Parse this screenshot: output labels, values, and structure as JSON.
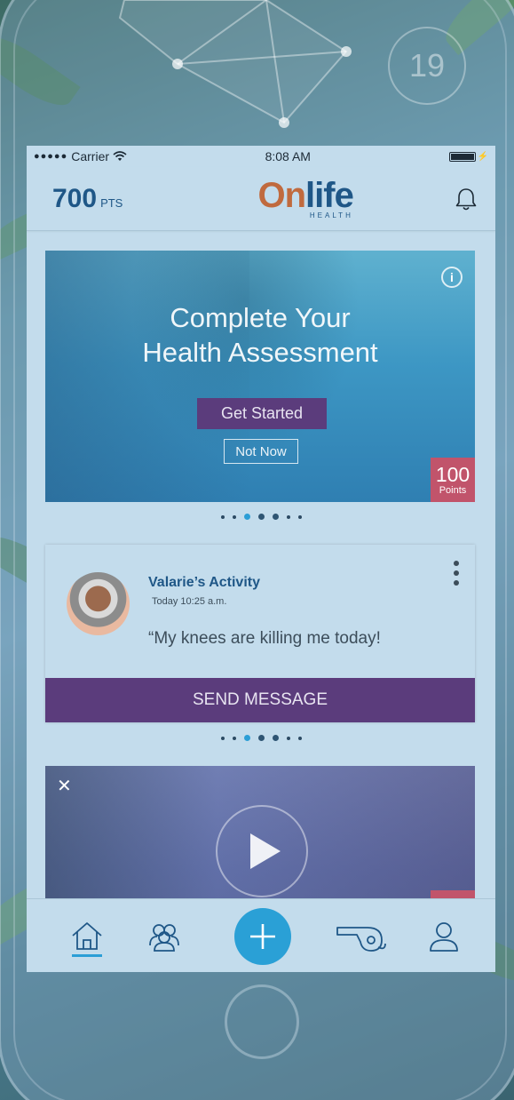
{
  "device": {
    "decor_number": "19"
  },
  "status_bar": {
    "carrier": "Carrier",
    "time": "8:08 AM"
  },
  "header": {
    "points_value": "700",
    "points_label": "PTS",
    "logo_brand_o": "On",
    "logo_brand_rest": "life",
    "logo_sub": "HEALTH"
  },
  "promo_card": {
    "title_line1": "Complete Your",
    "title_line2": "Health Assessment",
    "primary_button": "Get Started",
    "secondary_button": "Not Now",
    "badge_points": "100",
    "badge_label": "Points"
  },
  "activity_card": {
    "title": "Valarie’s Activity",
    "timestamp": "Today 10:25 a.m.",
    "quote": "“My knees are killing me today!",
    "action_button": "SEND MESSAGE"
  },
  "tab_bar": {
    "items": [
      "home-icon",
      "community-icon",
      "add-icon",
      "coach-whistle-icon",
      "profile-icon"
    ],
    "active": "home"
  },
  "colors": {
    "accent_blue": "#2aa0d6",
    "brand_purple": "#5b3c7c",
    "brand_navy": "#1f5787",
    "brand_orange": "#c06a3e",
    "badge_red": "#c1546b"
  }
}
